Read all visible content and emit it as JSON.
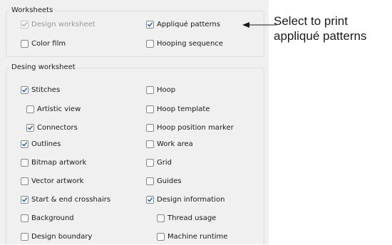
{
  "worksheets": {
    "legend": "Worksheets",
    "items": [
      {
        "label": "Design worksheet",
        "checked": true,
        "disabled": true
      },
      {
        "label": "Appliqué patterns",
        "checked": true,
        "disabled": false
      },
      {
        "label": "Color film",
        "checked": false,
        "disabled": false
      },
      {
        "label": "Hooping sequence",
        "checked": false,
        "disabled": false
      }
    ]
  },
  "design_worksheet": {
    "legend": "Desing worksheet",
    "items": [
      {
        "label": "Stitches",
        "checked": true
      },
      {
        "label": "Hoop",
        "checked": false
      },
      {
        "label": "Artistic view",
        "checked": false
      },
      {
        "label": "Hoop template",
        "checked": false
      },
      {
        "label": "Connectors",
        "checked": true
      },
      {
        "label": "Hoop position marker",
        "checked": false
      },
      {
        "label": "Outlines",
        "checked": true
      },
      {
        "label": "Work area",
        "checked": false
      },
      {
        "label": "Bitmap artwork",
        "checked": false
      },
      {
        "label": "Grid",
        "checked": false
      },
      {
        "label": "Vector artwork",
        "checked": false
      },
      {
        "label": "Guides",
        "checked": false
      },
      {
        "label": "Start & end crosshairs",
        "checked": true
      },
      {
        "label": "Design information",
        "checked": true
      },
      {
        "label": "Background",
        "checked": false
      },
      {
        "label": "Thread usage",
        "checked": false
      },
      {
        "label": "Design boundary",
        "checked": false
      },
      {
        "label": "Machine runtime",
        "checked": false
      }
    ]
  },
  "callout": {
    "line1": "Select to print",
    "line2": "appliqué patterns"
  },
  "icons": {
    "checkmark": "checkmark-icon",
    "arrow": "arrow-left-icon"
  },
  "colors": {
    "panel_bg": "#f0f0f0",
    "group_border": "#d5dfe5",
    "check_blue": "#2f6fb0",
    "disabled_text": "#9a9a9a"
  }
}
